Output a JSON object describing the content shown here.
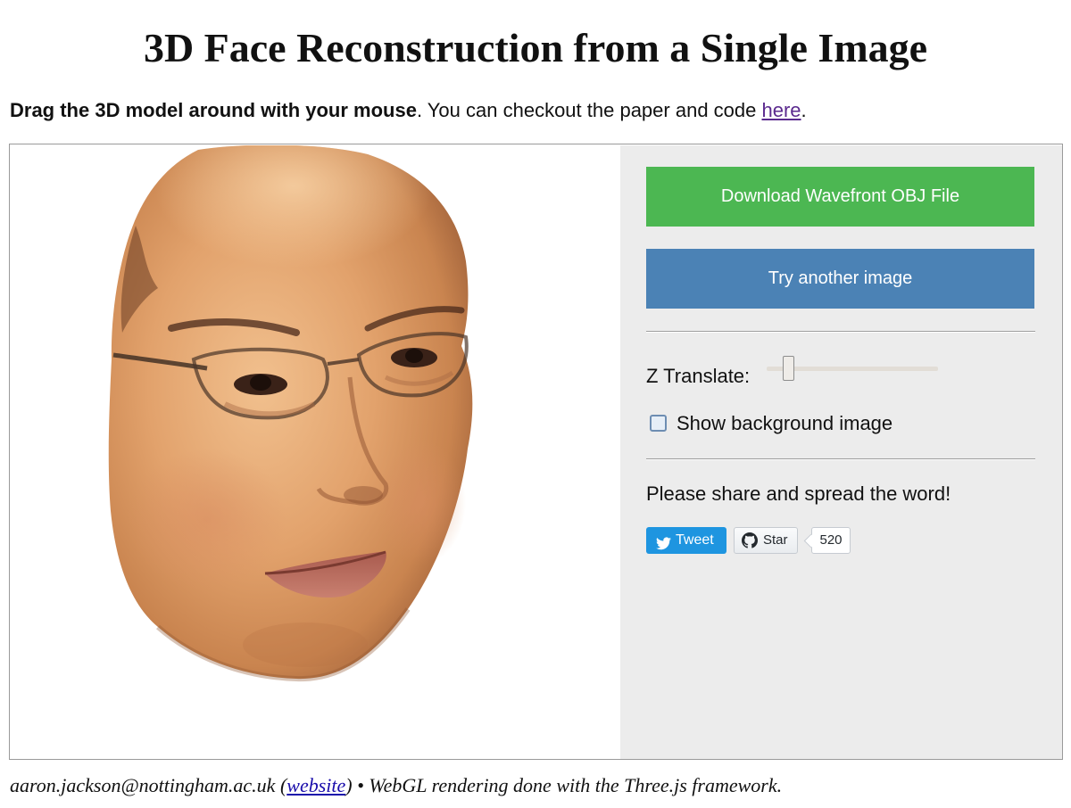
{
  "page": {
    "title": "3D Face Reconstruction from a Single Image"
  },
  "intro": {
    "bold_text": "Drag the 3D model around with your mouse",
    "text": ". You can checkout the paper and code ",
    "link_text": "here",
    "end": "."
  },
  "viewer": {
    "icon": "3d-face-model"
  },
  "panel": {
    "download_button": "Download Wavefront OBJ File",
    "try_button": "Try another image",
    "z_translate_label": "Z Translate:",
    "z_translate_value": 0.1,
    "show_background_label": "Show background image",
    "show_background_checked": false,
    "share_text": "Please share and spread the word!",
    "tweet_label": "Tweet",
    "star_label": "Star",
    "star_count": "520"
  },
  "colors": {
    "download_button": "#4cb752",
    "try_button": "#4b82b5",
    "panel_background": "#ececec",
    "tweet_button": "#1e95e0"
  },
  "footer": {
    "email": "aaron.jackson@nottingham.ac.uk",
    "open_paren": " (",
    "website_link": "website",
    "rest": ") • WebGL rendering done with the Three.js framework."
  }
}
